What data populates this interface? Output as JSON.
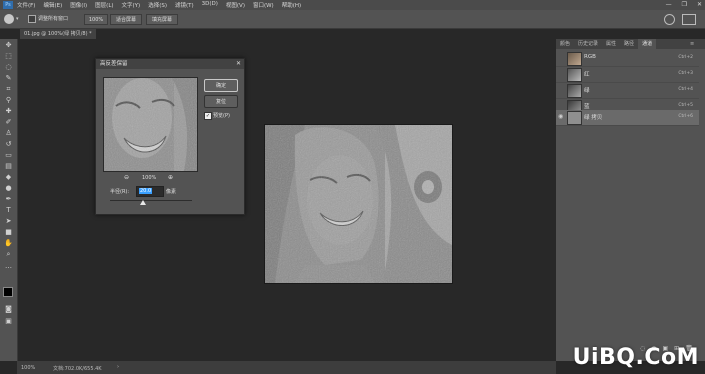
{
  "menubar": {
    "logo": "Ps",
    "items": [
      "文件(F)",
      "编辑(E)",
      "图像(I)",
      "图层(L)",
      "文字(Y)",
      "选择(S)",
      "滤镜(T)",
      "3D(D)",
      "视图(V)",
      "窗口(W)",
      "帮助(H)"
    ],
    "win_controls": [
      "—",
      "❐",
      "✕"
    ]
  },
  "options": {
    "checkbox_label": "调整所有窗口",
    "btn_100": "100%",
    "btn_fit": "适合屏幕",
    "btn_fill": "填充屏幕"
  },
  "document": {
    "tab_title": "01.jpg @ 100%(绿 拷贝/8) *"
  },
  "dialog": {
    "title": "高反差保留",
    "ok": "确定",
    "reset": "复位",
    "preview_check": "预览(P)",
    "zoom": "100%",
    "radius_label": "半径(R):",
    "radius_value": "20.0",
    "unit": "像素",
    "slider_position": 0.4
  },
  "right_panel": {
    "tabs": [
      "颜色",
      "历史记录",
      "属性",
      "路径",
      "通道"
    ],
    "active_tab": "通道",
    "channels": [
      {
        "name": "RGB",
        "key": "Ctrl+2"
      },
      {
        "name": "红",
        "key": "Ctrl+3"
      },
      {
        "name": "绿",
        "key": "Ctrl+4"
      },
      {
        "name": "蓝",
        "key": "Ctrl+5"
      },
      {
        "name": "绿 拷贝",
        "key": "Ctrl+6"
      }
    ],
    "bottom_icons": [
      "◌",
      "◍",
      "▣",
      "⊞",
      "🗑"
    ]
  },
  "status": {
    "zoom": "100%",
    "doc": "文档:702.0K/655.4K"
  },
  "watermark": "UiBQ.CoM",
  "colors": {
    "accent_blue": "#2f6dac",
    "highlight": "#3aa0ff"
  }
}
